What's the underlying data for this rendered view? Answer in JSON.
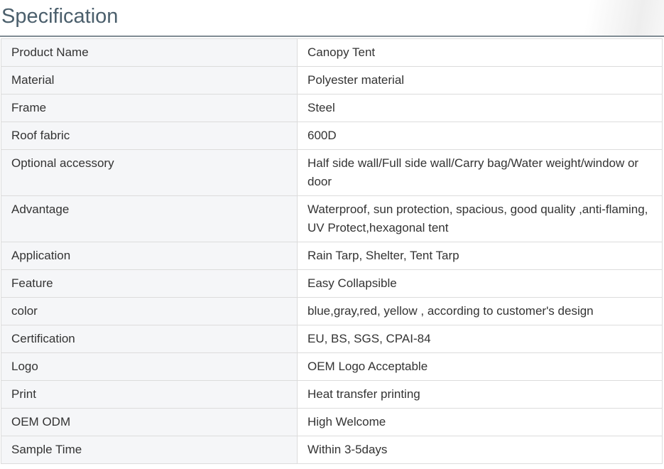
{
  "page": {
    "title": "Specification"
  },
  "spec": {
    "rows": [
      {
        "label": "Product Name",
        "value": "Canopy Tent"
      },
      {
        "label": "Material",
        "value": "Polyester material"
      },
      {
        "label": "Frame",
        "value": "Steel"
      },
      {
        "label": "Roof fabric",
        "value": "600D"
      },
      {
        "label": "Optional accessory",
        "value": "Half side wall/Full side wall/Carry bag/Water weight/window or door"
      },
      {
        "label": "Advantage",
        "value": "Waterproof, sun protection, spacious, good quality ,anti-flaming, UV Protect,hexagonal tent"
      },
      {
        "label": "Application",
        "value": "Rain Tarp, Shelter, Tent Tarp"
      },
      {
        "label": "Feature",
        "value": "Easy Collapsible"
      },
      {
        "label": "color",
        "value": "blue,gray,red, yellow , according to customer's design"
      },
      {
        "label": "Certification",
        "value": "EU, BS, SGS, CPAI-84"
      },
      {
        "label": "Logo",
        "value": "OEM Logo Acceptable"
      },
      {
        "label": "Print",
        "value": "Heat transfer printing"
      },
      {
        "label": "OEM ODM",
        "value": "High Welcome"
      },
      {
        "label": "Sample Time",
        "value": "Within 3-5days"
      }
    ]
  }
}
